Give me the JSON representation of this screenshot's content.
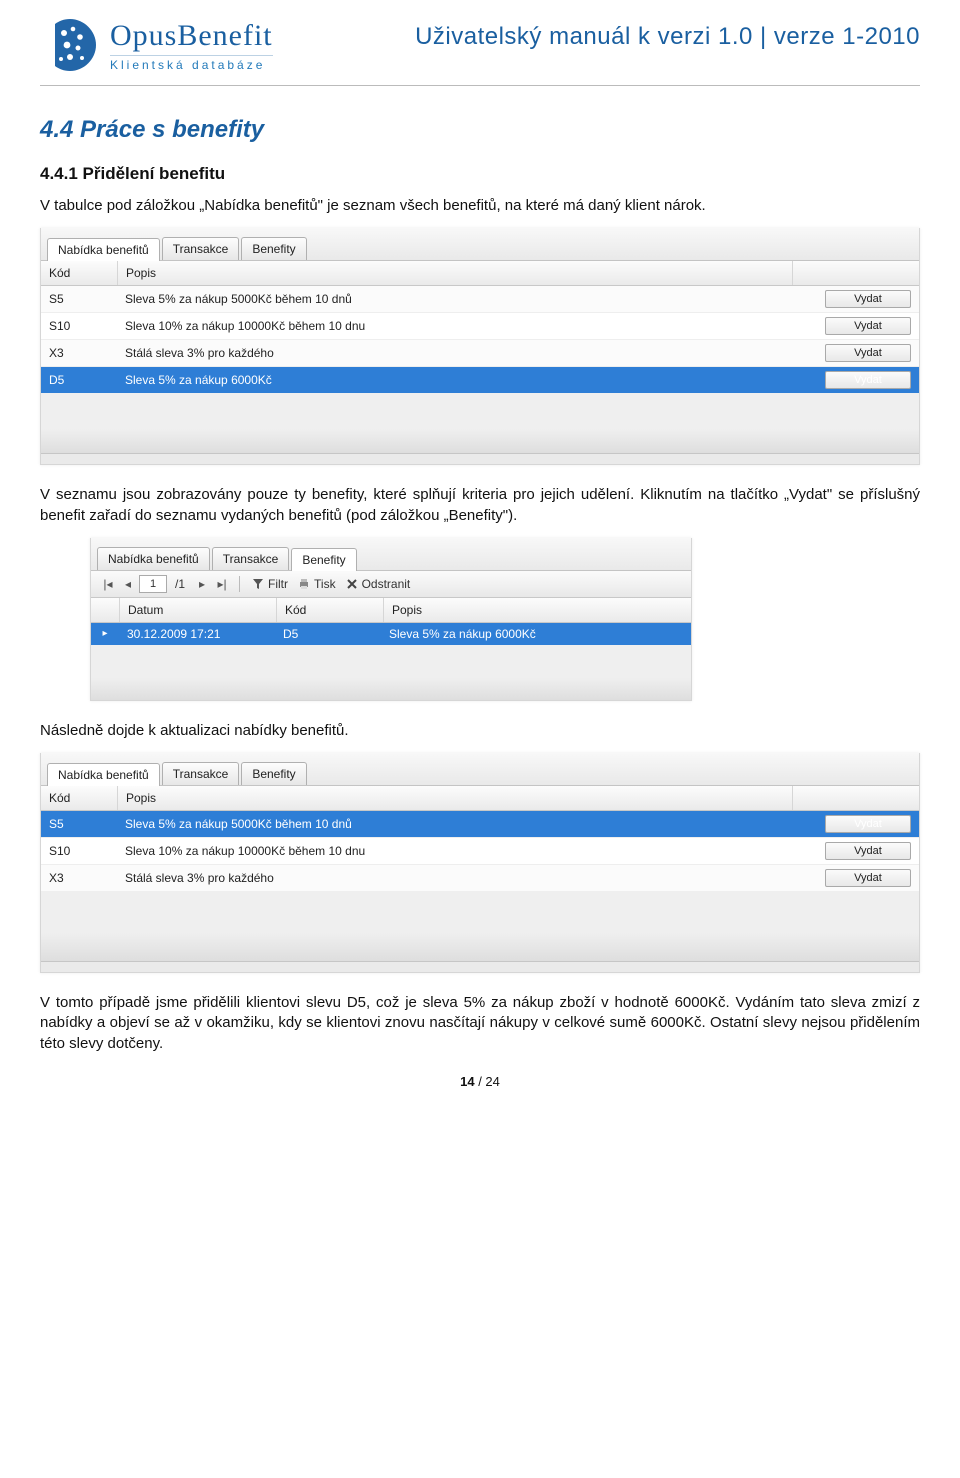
{
  "header": {
    "logo_main": "OpusBenefit",
    "logo_sub": "Klientská databáze",
    "doc_title": "Uživatelský manuál k verzi 1.0 | verze 1-2010"
  },
  "section": {
    "h2": "4.4 Práce s benefity",
    "h3": "4.4.1 Přidělení benefitu",
    "p1": "V tabulce pod záložkou „Nabídka benefitů\" je seznam všech benefitů, na které má daný klient nárok.",
    "p2": "V seznamu jsou zobrazovány pouze ty benefity, které splňují kriteria pro jejich udělení. Kliknutím na tlačítko „Vydat\" se příslušný benefit zařadí do seznamu vydaných benefitů (pod záložkou „Benefity\").",
    "p3": "Následně dojde k aktualizaci nabídky benefitů.",
    "p4": "V tomto případě jsme přidělili klientovi slevu D5, což je sleva 5% za nákup zboží v hodnotě 6000Kč. Vydáním tato sleva zmizí z nabídky a objeví se až v okamžiku, kdy se klientovi znovu nasčítají nákupy v celkové sumě 6000Kč. Ostatní slevy nejsou přidělením této slevy dotčeny."
  },
  "tabs": {
    "nabidka": "Nabídka benefitů",
    "transakce": "Transakce",
    "benefity": "Benefity"
  },
  "grid_headers": {
    "kod": "Kód",
    "popis": "Popis",
    "datum": "Datum"
  },
  "buttons": {
    "vydat": "Vydat"
  },
  "toolbar": {
    "page_current": "1",
    "page_total": "/1",
    "filtr": "Filtr",
    "tisk": "Tisk",
    "odstranit": "Odstranit"
  },
  "shot1_rows": [
    {
      "kod": "S5",
      "popis": "Sleva 5% za nákup 5000Kč během 10 dnů",
      "selected": false
    },
    {
      "kod": "S10",
      "popis": "Sleva 10% za nákup 10000Kč během 10 dnu",
      "selected": false
    },
    {
      "kod": "X3",
      "popis": "Stálá sleva 3% pro každého",
      "selected": false
    },
    {
      "kod": "D5",
      "popis": "Sleva 5% za nákup 6000Kč",
      "selected": true
    }
  ],
  "shot2_rows": [
    {
      "datum": "30.12.2009 17:21",
      "kod": "D5",
      "popis": "Sleva 5% za nákup 6000Kč",
      "selected": true
    }
  ],
  "shot3_rows": [
    {
      "kod": "S5",
      "popis": "Sleva 5% za nákup 5000Kč během 10 dnů",
      "selected": true
    },
    {
      "kod": "S10",
      "popis": "Sleva 10% za nákup 10000Kč během 10 dnu",
      "selected": false
    },
    {
      "kod": "X3",
      "popis": "Stálá sleva 3% pro každého",
      "selected": false
    }
  ],
  "footer": {
    "current": "14",
    "sep": " / ",
    "total": "24"
  }
}
